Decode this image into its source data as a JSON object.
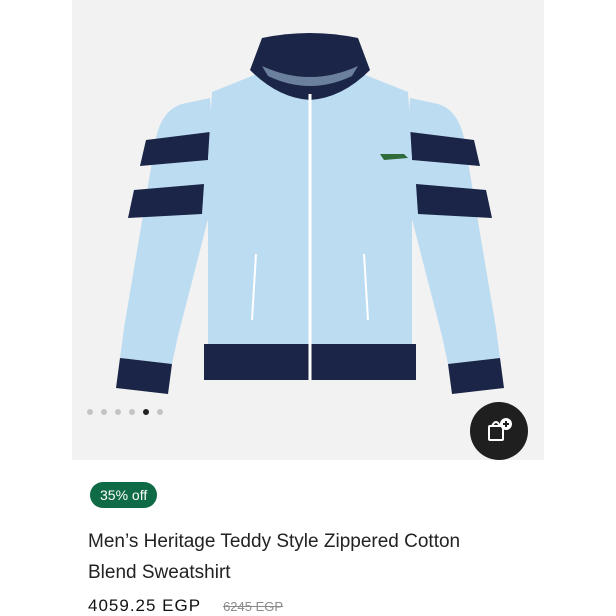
{
  "product": {
    "image_alt": "Light blue zip-up sweatshirt with navy stripes",
    "carousel": {
      "total": 6,
      "active": 5
    },
    "discount_badge": "35% off",
    "title": "Men’s Heritage Teddy Style Zippered Cotton Blend Sweatshirt",
    "price": "4059.25 EGP",
    "original_price": "6245 EGP"
  },
  "actions": {
    "add_to_bag_icon": "shopping-bag-plus-icon"
  },
  "colors": {
    "jacket": "#bcdcf1",
    "navy": "#1b2547",
    "badge": "#0f6b45",
    "fab": "#1f1f1f"
  }
}
